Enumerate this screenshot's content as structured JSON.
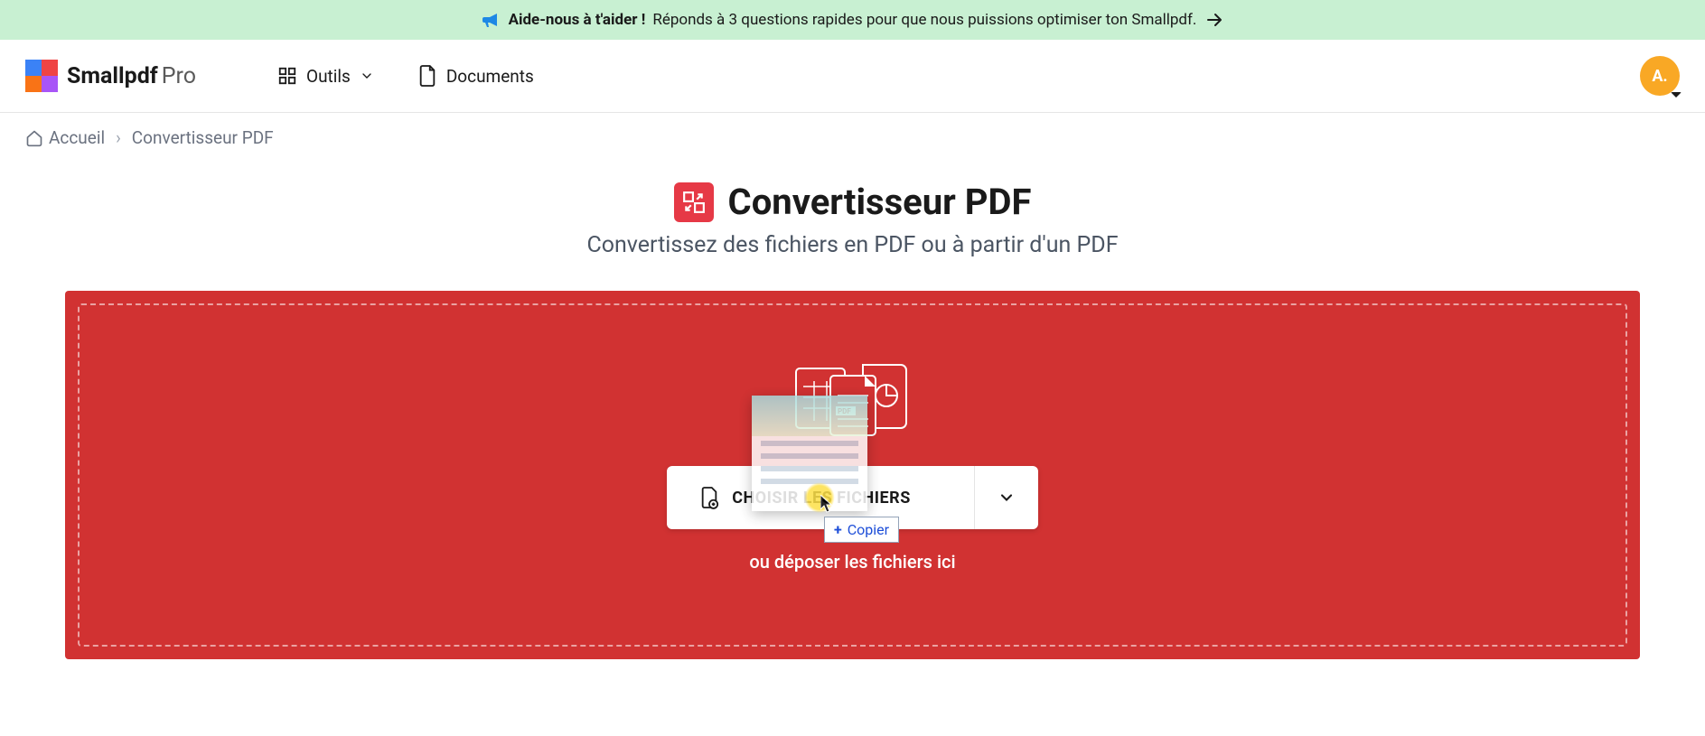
{
  "banner": {
    "bold": "Aide-nous à t'aider !",
    "text": "Réponds à 3 questions rapides pour que nous puissions optimiser ton Smallpdf."
  },
  "header": {
    "brand": "Smallpdf",
    "brand_suffix": "Pro",
    "nav": {
      "tools": "Outils",
      "documents": "Documents"
    },
    "avatar_initial": "A."
  },
  "breadcrumb": {
    "home": "Accueil",
    "current": "Convertisseur PDF"
  },
  "hero": {
    "title": "Convertisseur PDF",
    "subtitle": "Convertissez des fichiers en PDF ou à partir d'un PDF"
  },
  "dropzone": {
    "choose_label": "CHOISIR LES FICHIERS",
    "drop_hint": "ou déposer les fichiers ici",
    "pdf_badge": "PDF"
  },
  "drag": {
    "copy_label": "Copier"
  }
}
